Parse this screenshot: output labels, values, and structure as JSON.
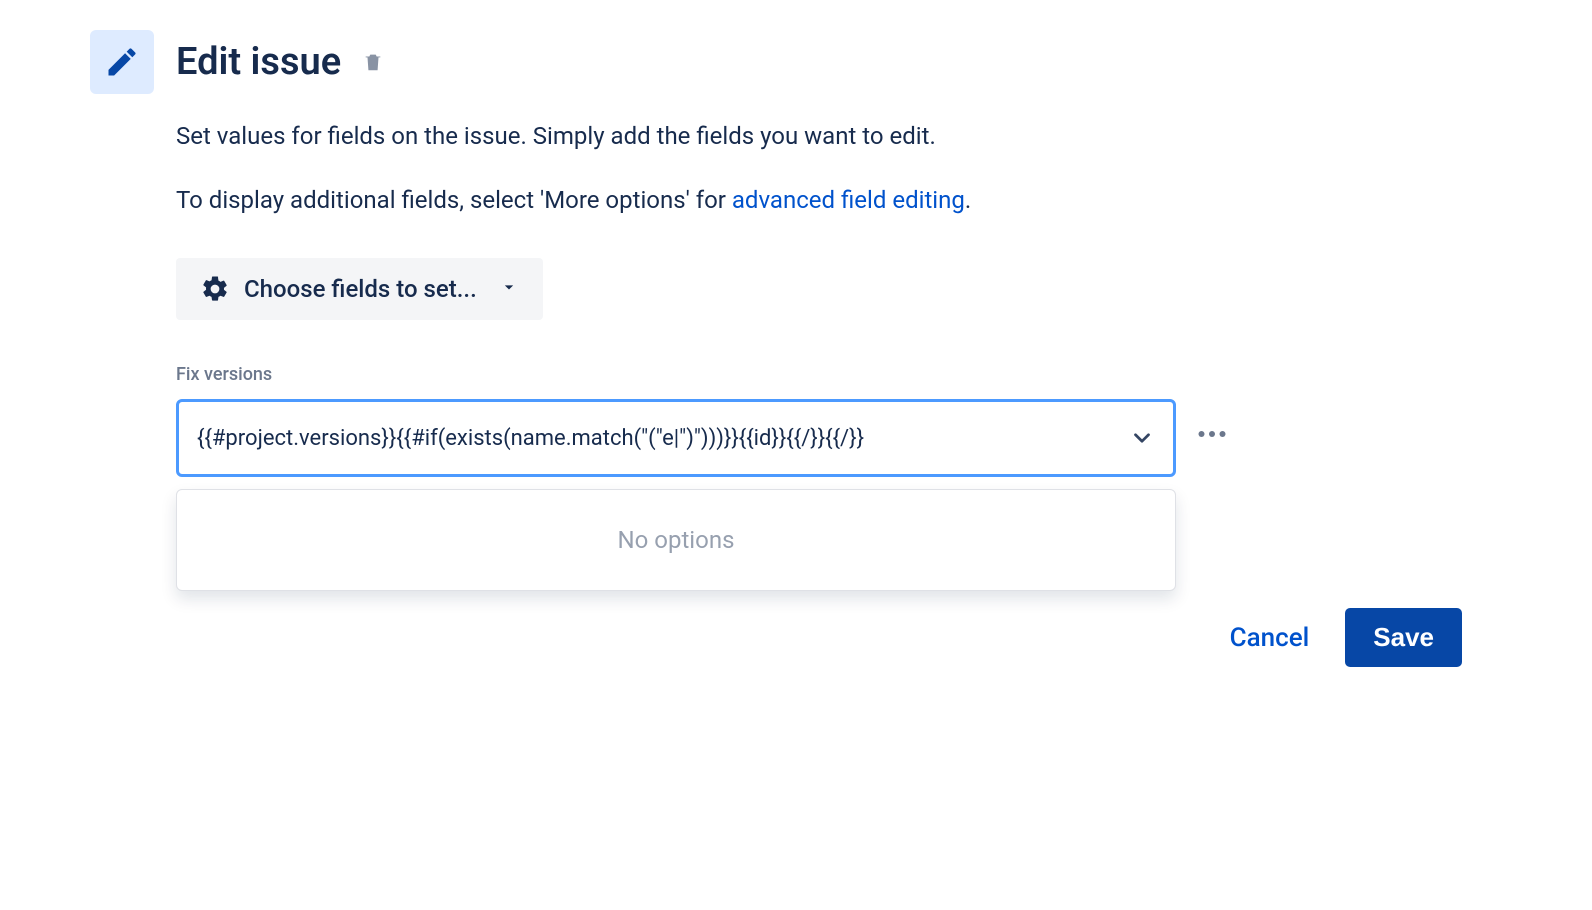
{
  "header": {
    "title": "Edit issue"
  },
  "description": {
    "line1": "Set values for fields on the issue. Simply add the fields you want to edit.",
    "line2_prefix": "To display additional fields, select 'More options' for ",
    "line2_link": "advanced field editing",
    "line2_suffix": "."
  },
  "chooseFields": {
    "label": "Choose fields to set..."
  },
  "field": {
    "label": "Fix versions",
    "value": "{{#project.versions}}{{#if(exists(name.match(\"(\"e|\")\")))}}{{id}}{{/}}{{/}}"
  },
  "dropdown": {
    "noOptions": "No options"
  },
  "footer": {
    "cancel": "Cancel",
    "save": "Save"
  }
}
